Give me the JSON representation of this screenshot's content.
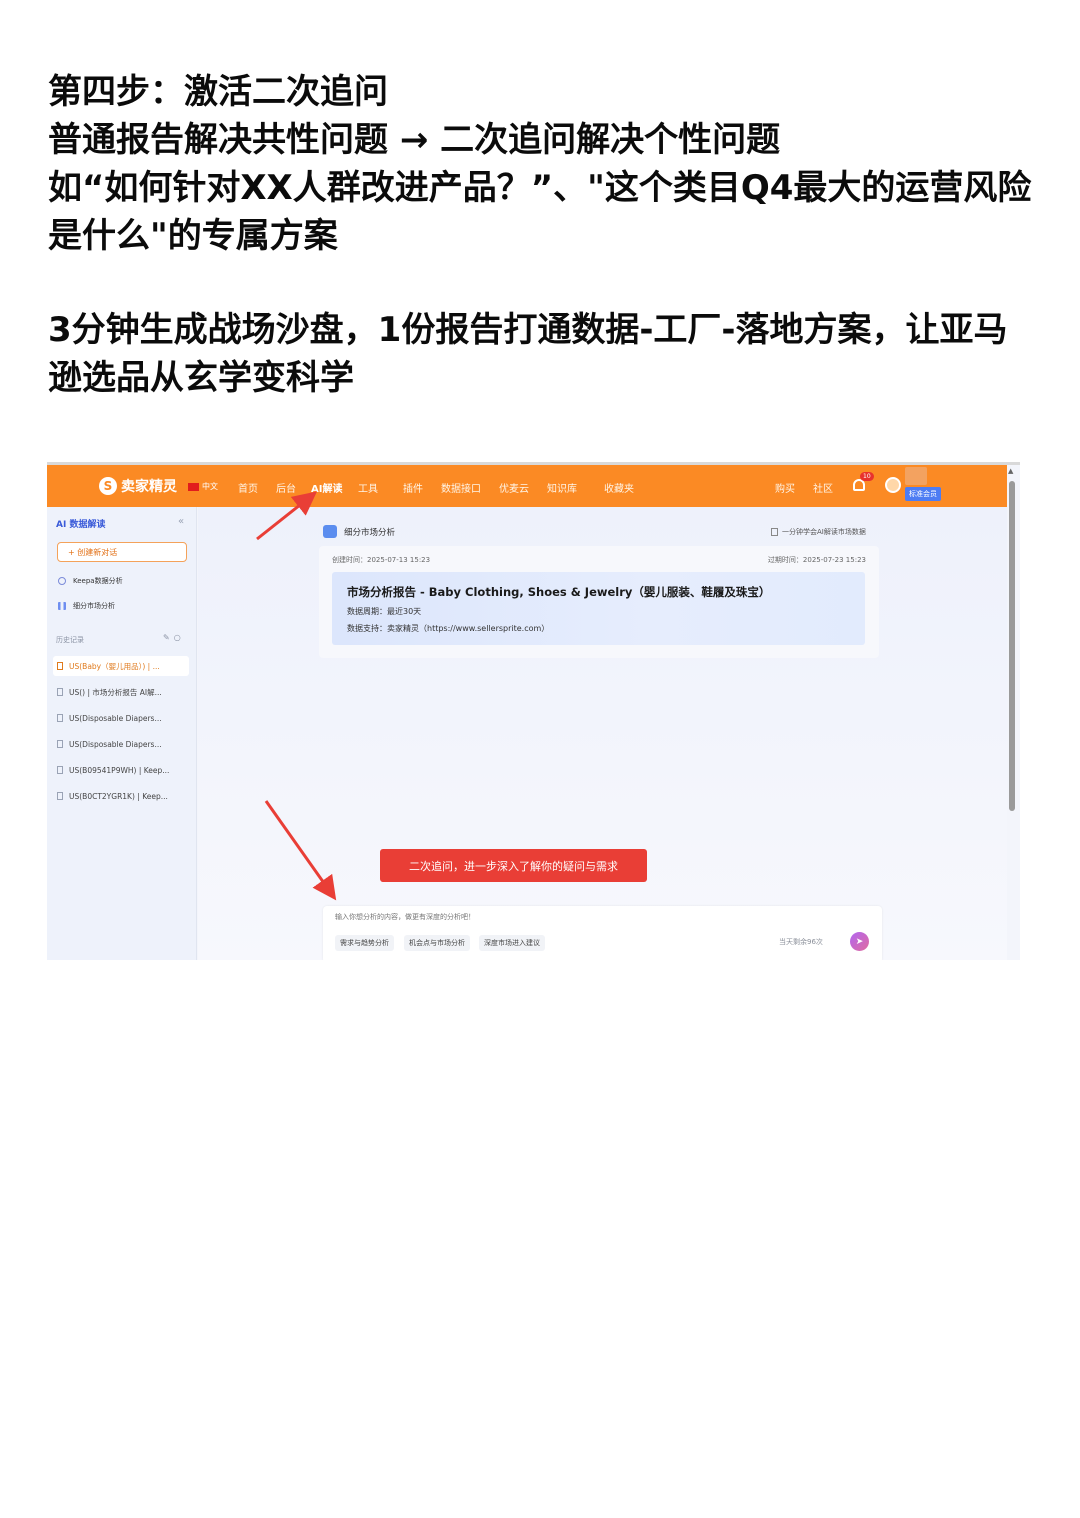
{
  "headline": {
    "line1": "第四步：激活二次追问",
    "line2": "普通报告解决共性问题 → 二次追问解决个性问题",
    "line3": "如“如何针对XX人群改进产品？”、\"这个类目Q4最大的运营风险是什么\"的专属方案",
    "line4": "3分钟生成战场沙盘，1份报告打通数据-工厂-落地方案，让亚马逊选品从玄学变科学"
  },
  "navbar": {
    "logo": "卖家精灵",
    "lang": "中文",
    "items": [
      "首页",
      "后台",
      "AI解读",
      "工具",
      "插件",
      "数据接口",
      "优麦云",
      "知识库",
      "收藏夹"
    ],
    "right_items": [
      "购买",
      "社区"
    ],
    "notification_count": "10",
    "member_badge": "标准会员"
  },
  "sidebar": {
    "title": "AI 数据解读",
    "new_chat": "+ 创建新对话",
    "links": [
      "Keepa数据分析",
      "细分市场分析"
    ],
    "history_label": "历史记录",
    "history": [
      "US(Baby（婴儿用品）) | ...",
      "US() | 市场分析报告 AI解...",
      "US(Disposable Diapers...",
      "US(Disposable Diapers...",
      "US(B09541P9WH) | Keep...",
      "US(B0CT2YGR1K) | Keep..."
    ]
  },
  "main": {
    "module_title": "细分市场分析",
    "tip_link": "一分钟学会AI解读市场数据",
    "report": {
      "created": "创建时间：2025-07-13 15:23",
      "expires": "过期时间：2025-07-23 15:23",
      "title": "市场分析报告 - Baby Clothing, Shoes & Jewelry（婴儿服装、鞋履及珠宝）",
      "period": "数据周期：最近30天",
      "source": "数据支持：卖家精灵（https://www.sellersprite.com）"
    },
    "callout": "二次追问，进一步深入了解你的疑问与需求",
    "composer": {
      "placeholder": "输入你想分析的内容，做更有深度的分析吧！",
      "chips": [
        "需求与趋势分析",
        "机会点与市场分析",
        "深度市场进入建议"
      ],
      "quota": "当天剩余96次"
    }
  },
  "colors": {
    "brand_orange": "#fb8a24",
    "callout_red": "#e93e36",
    "accent_blue": "#3a5bd9"
  }
}
